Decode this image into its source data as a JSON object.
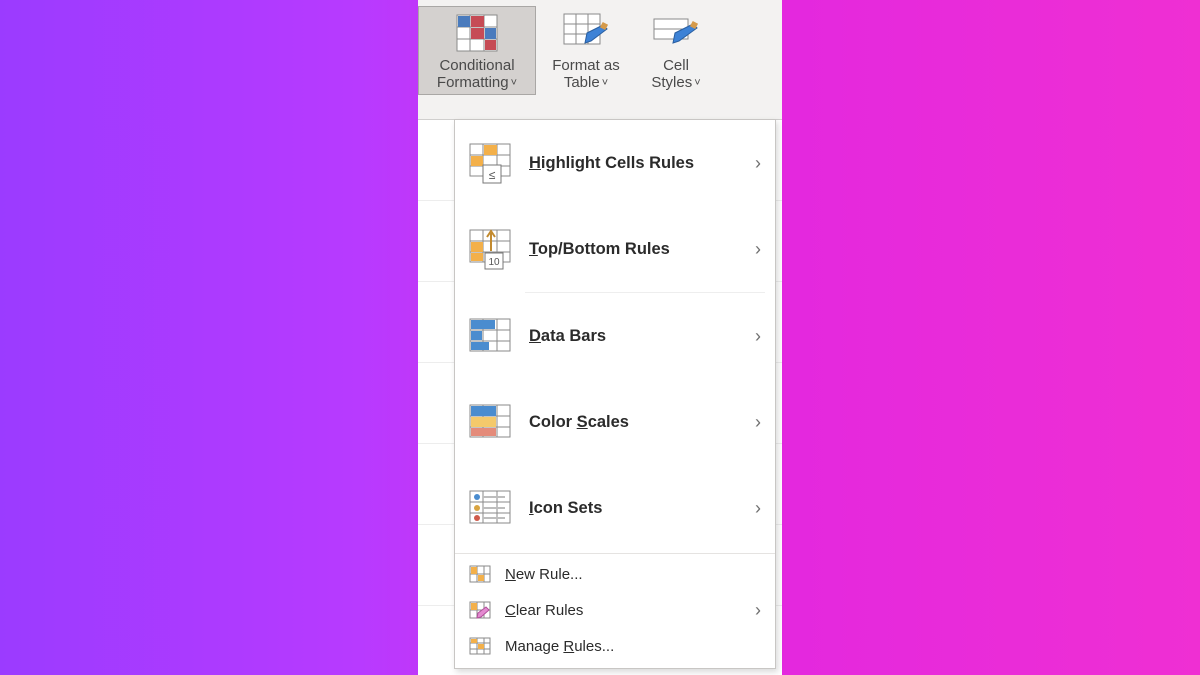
{
  "ribbon": {
    "conditional_formatting": {
      "line1": "Conditional",
      "line2": "Formatting"
    },
    "format_as_table": {
      "line1": "Format as",
      "line2": "Table"
    },
    "cell_styles": {
      "line1": "Cell",
      "line2": "Styles"
    },
    "caret": "˅"
  },
  "menu": {
    "highlight_cells_rules": {
      "pre": "",
      "ul": "H",
      "post": "ighlight Cells Rules"
    },
    "top_bottom_rules": {
      "pre": "",
      "ul": "T",
      "post": "op/Bottom Rules"
    },
    "data_bars": {
      "pre": "",
      "ul": "D",
      "post": "ata Bars"
    },
    "color_scales": {
      "pre": "Color ",
      "ul": "S",
      "post": "cales"
    },
    "icon_sets": {
      "pre": "",
      "ul": "I",
      "post": "con Sets"
    },
    "new_rule": {
      "pre": "",
      "ul": "N",
      "post": "ew Rule..."
    },
    "clear_rules": {
      "pre": "",
      "ul": "C",
      "post": "lear Rules"
    },
    "manage_rules": {
      "pre": "Manage ",
      "ul": "R",
      "post": "ules..."
    }
  },
  "glyphs": {
    "chevron_right": "›"
  }
}
